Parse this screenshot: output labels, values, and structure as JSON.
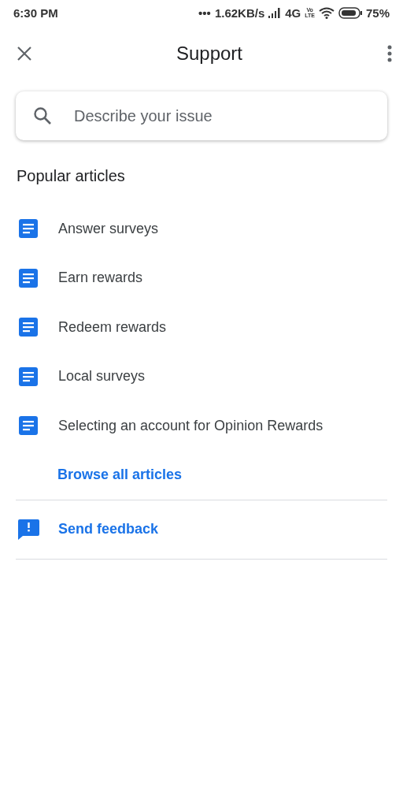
{
  "status_bar": {
    "time": "6:30 PM",
    "dots": "•••",
    "speed": "1.62KB/s",
    "network": "4G",
    "volte_top": "Vo",
    "volte_bottom": "LTE",
    "battery": "75%"
  },
  "header": {
    "title": "Support"
  },
  "search": {
    "placeholder": "Describe your issue"
  },
  "section_title": "Popular articles",
  "articles": [
    {
      "title": "Answer surveys"
    },
    {
      "title": "Earn rewards"
    },
    {
      "title": "Redeem rewards"
    },
    {
      "title": "Local surveys"
    },
    {
      "title": "Selecting an account for Opinion Rewards"
    }
  ],
  "browse_link": "Browse all articles",
  "feedback_link": "Send feedback"
}
